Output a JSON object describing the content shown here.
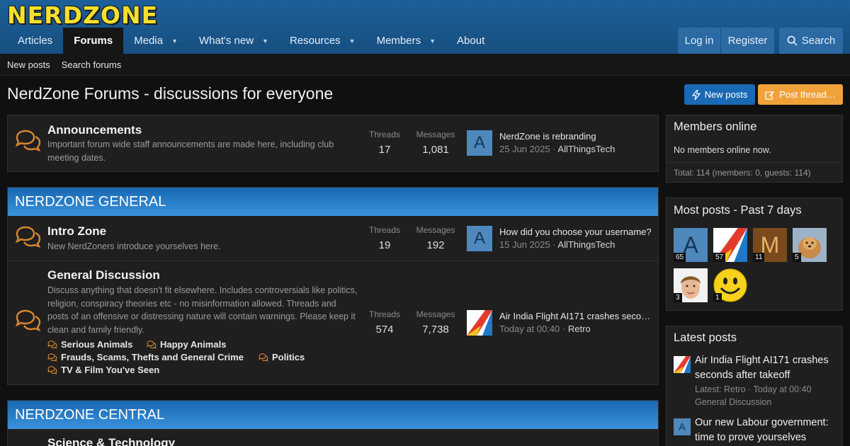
{
  "site": {
    "logo": "NERDZONE",
    "nav": [
      {
        "label": "Articles",
        "caret": false,
        "active": false
      },
      {
        "label": "Forums",
        "caret": false,
        "active": true
      },
      {
        "label": "Media",
        "caret": true,
        "active": false
      },
      {
        "label": "What's new",
        "caret": true,
        "active": false
      },
      {
        "label": "Resources",
        "caret": true,
        "active": false
      },
      {
        "label": "Members",
        "caret": true,
        "active": false
      },
      {
        "label": "About",
        "caret": false,
        "active": false
      }
    ],
    "login": "Log in",
    "register": "Register",
    "search": "Search"
  },
  "subnav": {
    "new_posts": "New posts",
    "search_forums": "Search forums"
  },
  "page": {
    "title": "NerdZone Forums - discussions for everyone",
    "new_posts_button": "New posts",
    "post_thread_button": "Post thread…"
  },
  "labels": {
    "threads": "Threads",
    "messages": "Messages"
  },
  "announcements": {
    "title": "Announcements",
    "description": "Important forum wide staff announcements are made here, including club meeting dates.",
    "threads": "17",
    "messages": "1,081",
    "latest_avatar": "A",
    "latest_title": "NerdZone is rebranding",
    "latest_date": "25 Jun 2025",
    "latest_user": "AllThingsTech"
  },
  "general": {
    "heading": "NERDZONE GENERAL",
    "intro": {
      "title": "Intro Zone",
      "description": "New NerdZoners introduce yourselves here.",
      "threads": "19",
      "messages": "192",
      "latest_avatar": "A",
      "latest_title": "How did you choose your username?",
      "latest_date": "15 Jun 2025",
      "latest_user": "AllThingsTech"
    },
    "discussion": {
      "title": "General Discussion",
      "description": "Discuss anything that doesn't fit elsewhere. Includes controversials like politics, religion, conspiracy theories etc - no misinformation allowed. Threads and posts of an offensive or distressing nature will contain warnings. Please keep it clean and family friendly.",
      "threads": "574",
      "messages": "7,738",
      "latest_title": "Air India Flight AI171 crashes secon…",
      "latest_date": "Today at 00:40",
      "latest_user": "Retro",
      "subforums": [
        "Serious Animals",
        "Happy Animals",
        "Frauds, Scams, Thefts and General Crime",
        "Politics",
        "TV & Film You've Seen"
      ]
    }
  },
  "central": {
    "heading": "NERDZONE CENTRAL",
    "first_node_title": "Science & Technology"
  },
  "sidebar": {
    "members_online": {
      "title": "Members online",
      "text": "No members online now.",
      "total": "Total: 114 (members: 0, guests: 114)"
    },
    "most_posts": {
      "title": "Most posts - Past 7 days",
      "members": [
        {
          "avatar": "A",
          "count": "65"
        },
        {
          "avatar": "flag-logo",
          "count": "57"
        },
        {
          "avatar": "M",
          "count": "11"
        },
        {
          "avatar": "dog-photo",
          "count": "5"
        },
        {
          "avatar": "person-photo",
          "count": "3"
        },
        {
          "avatar": "smiley",
          "count": "1"
        }
      ]
    },
    "latest_posts": {
      "title": "Latest posts",
      "items": [
        {
          "title": "Air India Flight AI171 crashes seconds after takeoff",
          "meta": "Latest: Retro · Today at 00:40",
          "forum": "General Discussion"
        },
        {
          "title": "Our new Labour government: time to prove yourselves",
          "avatar": "A"
        }
      ]
    }
  },
  "colors": {
    "header": "#1c5f99",
    "category_header": "#3c92dd",
    "accent_orange": "#f0a23a",
    "primary_button": "#1a69b5",
    "logo_yellow": "#f7e02b",
    "speech_icon": "#d9862f"
  }
}
